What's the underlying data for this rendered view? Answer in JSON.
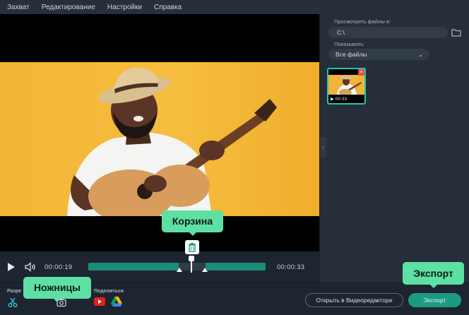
{
  "menu": [
    "Захват",
    "Редактирование",
    "Настройки",
    "Справка"
  ],
  "right_panel": {
    "browse_label": "Просмотреть файлы в:",
    "path": "C:\\",
    "show_label": "Показывать:",
    "filter": "Все файлы",
    "thumb_duration": "00:33"
  },
  "player": {
    "current_time": "00:00:19",
    "total_time": "00:00:33"
  },
  "bottom": {
    "split_label": "Разре",
    "share_label": "Поделиться",
    "open_editor": "Открыть в Видеоредакторе",
    "export": "Экспорт"
  },
  "callouts": {
    "trash": "Корзина",
    "scissors": "Ножницы",
    "export": "Экспорт"
  },
  "colors": {
    "accent": "#1b9b83",
    "callout": "#5ee0a4",
    "frame_bg": "#f3b536"
  }
}
